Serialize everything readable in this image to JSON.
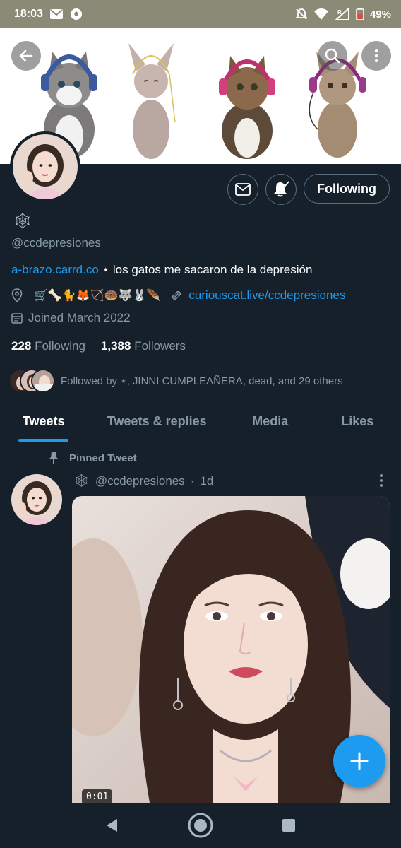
{
  "status_bar": {
    "time": "18:03",
    "battery": "49%",
    "signal_label": "R",
    "icons": [
      "mail-icon",
      "soccer-ball-icon",
      "mute-icon",
      "wifi-icon",
      "signal-icon",
      "battery-icon"
    ]
  },
  "header": {
    "back_icon": "arrow-left-icon",
    "search_icon": "search-icon",
    "more_icon": "more-vertical-icon"
  },
  "profile": {
    "name_emoji": "🕸",
    "handle": "@ccdepresiones",
    "bio_link": "a-brazo.carrd.co",
    "bio_text": " ⋆ los gatos me sacaron de la depresión",
    "location_emojis": "🛒🦴🐈🦊🏹🍩🐺🐰🪶",
    "website": "curiouscat.live/ccdepresiones",
    "joined": "Joined March 2022",
    "following_count": "228",
    "following_label": "Following",
    "followers_count": "1,388",
    "followers_label": "Followers",
    "followed_by": "Followed by ⋆, JINNI CUMPLEAÑERA, dead, and 29 others",
    "follow_button": "Following"
  },
  "tabs": [
    {
      "label": "Tweets",
      "active": true
    },
    {
      "label": "Tweets & replies",
      "active": false
    },
    {
      "label": "Media",
      "active": false
    },
    {
      "label": "Likes",
      "active": false
    }
  ],
  "tweet": {
    "pinned_label": "Pinned Tweet",
    "author_emoji": "🕸",
    "author_handle": "@ccdepresiones",
    "separator": "·",
    "age": "1d",
    "video_time": "0:01"
  },
  "colors": {
    "background": "#15202b",
    "accent": "#1d9bf0",
    "secondary_text": "#8899a6",
    "status_bar": "#8a8a76"
  }
}
